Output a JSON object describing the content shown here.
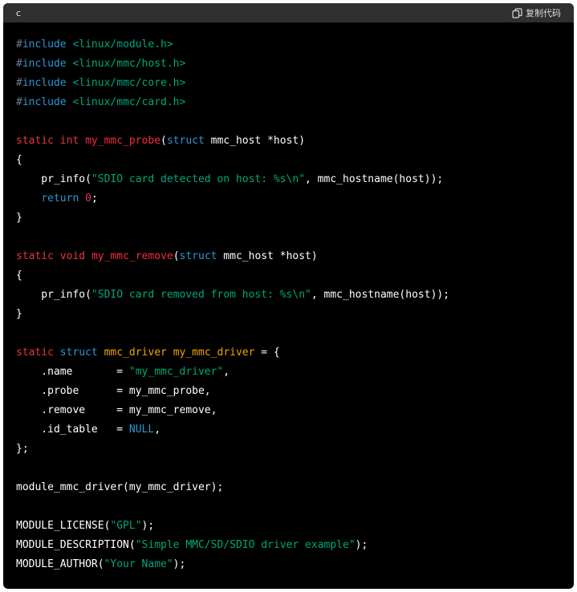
{
  "header": {
    "language": "c",
    "copy_label": "复制代码"
  },
  "code_lines": [
    [
      {
        "t": "#",
        "c": "pre"
      },
      {
        "t": "include",
        "c": "blue"
      },
      {
        "t": " ",
        "c": "plain"
      },
      {
        "t": "<linux/module.h>",
        "c": "str"
      }
    ],
    [
      {
        "t": "#",
        "c": "pre"
      },
      {
        "t": "include",
        "c": "blue"
      },
      {
        "t": " ",
        "c": "plain"
      },
      {
        "t": "<linux/mmc/host.h>",
        "c": "str"
      }
    ],
    [
      {
        "t": "#",
        "c": "pre"
      },
      {
        "t": "include",
        "c": "blue"
      },
      {
        "t": " ",
        "c": "plain"
      },
      {
        "t": "<linux/mmc/core.h>",
        "c": "str"
      }
    ],
    [
      {
        "t": "#",
        "c": "pre"
      },
      {
        "t": "include",
        "c": "blue"
      },
      {
        "t": " ",
        "c": "plain"
      },
      {
        "t": "<linux/mmc/card.h>",
        "c": "str"
      }
    ],
    [],
    [
      {
        "t": "static",
        "c": "kw"
      },
      {
        "t": " ",
        "c": "plain"
      },
      {
        "t": "int",
        "c": "kw"
      },
      {
        "t": " ",
        "c": "plain"
      },
      {
        "t": "my_mmc_probe",
        "c": "fn"
      },
      {
        "t": "(",
        "c": "plain"
      },
      {
        "t": "struct",
        "c": "blue"
      },
      {
        "t": " mmc_host *host)",
        "c": "plain"
      }
    ],
    [
      {
        "t": "{",
        "c": "plain"
      }
    ],
    [
      {
        "t": "    pr_info(",
        "c": "plain"
      },
      {
        "t": "\"SDIO card detected on host: %s\\n\"",
        "c": "str"
      },
      {
        "t": ", mmc_hostname(host));",
        "c": "plain"
      }
    ],
    [
      {
        "t": "    ",
        "c": "plain"
      },
      {
        "t": "return",
        "c": "blue"
      },
      {
        "t": " ",
        "c": "plain"
      },
      {
        "t": "0",
        "c": "num"
      },
      {
        "t": ";",
        "c": "plain"
      }
    ],
    [
      {
        "t": "}",
        "c": "plain"
      }
    ],
    [],
    [
      {
        "t": "static",
        "c": "kw"
      },
      {
        "t": " ",
        "c": "plain"
      },
      {
        "t": "void",
        "c": "kw"
      },
      {
        "t": " ",
        "c": "plain"
      },
      {
        "t": "my_mmc_remove",
        "c": "fn"
      },
      {
        "t": "(",
        "c": "plain"
      },
      {
        "t": "struct",
        "c": "blue"
      },
      {
        "t": " mmc_host *host)",
        "c": "plain"
      }
    ],
    [
      {
        "t": "{",
        "c": "plain"
      }
    ],
    [
      {
        "t": "    pr_info(",
        "c": "plain"
      },
      {
        "t": "\"SDIO card removed from host: %s\\n\"",
        "c": "str"
      },
      {
        "t": ", mmc_hostname(host));",
        "c": "plain"
      }
    ],
    [
      {
        "t": "}",
        "c": "plain"
      }
    ],
    [],
    [
      {
        "t": "static",
        "c": "kw"
      },
      {
        "t": " ",
        "c": "plain"
      },
      {
        "t": "struct",
        "c": "blue"
      },
      {
        "t": " ",
        "c": "plain"
      },
      {
        "t": "mmc_driver",
        "c": "org"
      },
      {
        "t": " ",
        "c": "plain"
      },
      {
        "t": "my_mmc_driver",
        "c": "org"
      },
      {
        "t": " = {",
        "c": "plain"
      }
    ],
    [
      {
        "t": "    .name       = ",
        "c": "plain"
      },
      {
        "t": "\"my_mmc_driver\"",
        "c": "str"
      },
      {
        "t": ",",
        "c": "plain"
      }
    ],
    [
      {
        "t": "    .probe      = my_mmc_probe,",
        "c": "plain"
      }
    ],
    [
      {
        "t": "    .remove     = my_mmc_remove,",
        "c": "plain"
      }
    ],
    [
      {
        "t": "    .id_table   = ",
        "c": "plain"
      },
      {
        "t": "NULL",
        "c": "blue"
      },
      {
        "t": ",",
        "c": "plain"
      }
    ],
    [
      {
        "t": "};",
        "c": "plain"
      }
    ],
    [],
    [
      {
        "t": "module_mmc_driver(my_mmc_driver);",
        "c": "plain"
      }
    ],
    [],
    [
      {
        "t": "MODULE_LICENSE(",
        "c": "plain"
      },
      {
        "t": "\"GPL\"",
        "c": "str"
      },
      {
        "t": ");",
        "c": "plain"
      }
    ],
    [
      {
        "t": "MODULE_DESCRIPTION(",
        "c": "plain"
      },
      {
        "t": "\"Simple MMC/SD/SDIO driver example\"",
        "c": "str"
      },
      {
        "t": ");",
        "c": "plain"
      }
    ],
    [
      {
        "t": "MODULE_AUTHOR(",
        "c": "plain"
      },
      {
        "t": "\"Your Name\"",
        "c": "str"
      },
      {
        "t": ");",
        "c": "plain"
      }
    ]
  ],
  "colors": {
    "background": "#000000",
    "header_bg": "#2f2f2f",
    "preprocessor": "#6e7a93",
    "keyword": "#e4373f",
    "type_keyword": "#2e95d3",
    "function_name": "#f22c3d",
    "string": "#00a67d",
    "struct_name": "#f0a400",
    "number": "#df3079"
  },
  "icons": {
    "copy": "copy-icon"
  }
}
